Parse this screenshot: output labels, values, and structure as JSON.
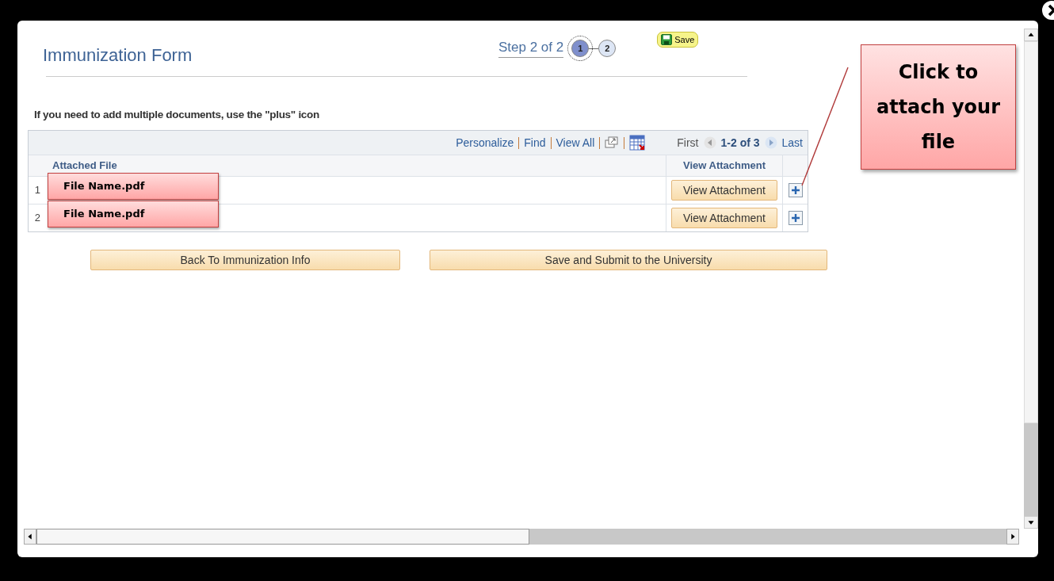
{
  "form": {
    "title": "Immunization Form",
    "step_text": "Step 2 of 2",
    "steps": [
      {
        "label": "1",
        "selected": true
      },
      {
        "label": "2",
        "selected": false
      }
    ],
    "save_button": "Save"
  },
  "instruction": "If you need to add multiple documents, use the \"plus\" icon",
  "grid": {
    "links": [
      "Personalize",
      "Find",
      "View All"
    ],
    "pager": {
      "first": "First",
      "range": "1-2 of 3",
      "last": "Last"
    },
    "columns": [
      "Attached File",
      "View Attachment"
    ],
    "rows": [
      {
        "number": "1",
        "view_button": "View Attachment"
      },
      {
        "number": "2",
        "view_button": "View Attachment"
      }
    ]
  },
  "buttons": [
    "Back To Immunization Info",
    "Save and Submit to the University"
  ],
  "callouts": [
    {
      "text": "File Name.pdf",
      "kind": "file"
    },
    {
      "text": "File Name.pdf",
      "kind": "file"
    },
    {
      "text": "Click to attach your file",
      "kind": "tip"
    }
  ]
}
